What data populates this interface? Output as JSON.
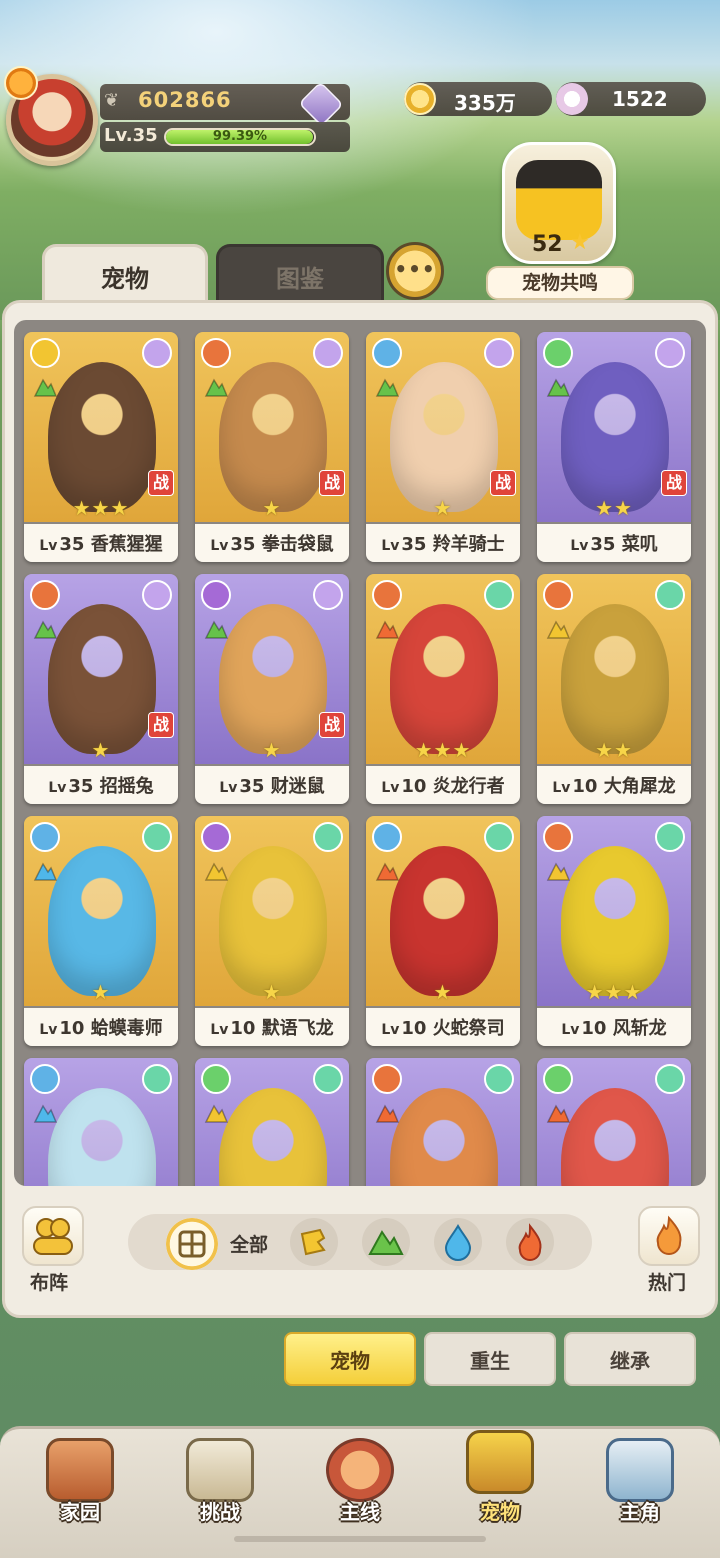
{
  "player": {
    "power": "602866",
    "level": "Lv.35",
    "exp_percent": "99.39%",
    "exp_fraction": 0.9939
  },
  "currency": {
    "gold": "335万",
    "shells": "1522"
  },
  "resonance": {
    "count": "52",
    "star": "★",
    "label": "宠物共鸣"
  },
  "chat": {
    "icon": "chat-bubble-icon",
    "glyph": "•••"
  },
  "tabs": [
    {
      "label": "宠物",
      "active": true
    },
    {
      "label": "图鉴",
      "active": false
    }
  ],
  "pets": [
    {
      "lv": "Lv",
      "level": "35",
      "name": "香蕉猩猩",
      "stars": "★★★",
      "battle": "战",
      "bg": "gold",
      "body": "#6b4a33",
      "tl": "#f2c531",
      "tr": "#c3a4ec",
      "el": "#66c24a"
    },
    {
      "lv": "Lv",
      "level": "35",
      "name": "拳击袋鼠",
      "stars": "★",
      "battle": "战",
      "bg": "gold",
      "body": "#c58a4d",
      "tl": "#e8743c",
      "tr": "#c3a4ec",
      "el": "#66c24a"
    },
    {
      "lv": "Lv",
      "level": "35",
      "name": "羚羊骑士",
      "stars": "★",
      "battle": "战",
      "bg": "gold",
      "body": "#f0cfae",
      "tl": "#5fb2e6",
      "tr": "#c3a4ec",
      "el": "#66c24a"
    },
    {
      "lv": "Lv",
      "level": "35",
      "name": "菜叽",
      "stars": "★★",
      "battle": "战",
      "bg": "purple",
      "body": "#6f5fc0",
      "tl": "#6bd06b",
      "tr": "#c3a4ec",
      "el": "#66c24a"
    },
    {
      "lv": "Lv",
      "level": "35",
      "name": "招摇兔",
      "stars": "★",
      "battle": "战",
      "bg": "purple",
      "body": "#7a5238",
      "tl": "#e8743c",
      "tr": "#c3a4ec",
      "el": "#66c24a"
    },
    {
      "lv": "Lv",
      "level": "35",
      "name": "财迷鼠",
      "stars": "★",
      "battle": "战",
      "bg": "purple",
      "body": "#e0a45a",
      "tl": "#a56ad6",
      "tr": "#c3a4ec",
      "el": "#66c24a"
    },
    {
      "lv": "Lv",
      "level": "10",
      "name": "炎龙行者",
      "stars": "★★★",
      "battle": "",
      "bg": "gold",
      "body": "#d6453a",
      "tl": "#e8743c",
      "tr": "#6ad6a8",
      "el": "#ef6a34"
    },
    {
      "lv": "Lv",
      "level": "10",
      "name": "大角犀龙",
      "stars": "★★",
      "battle": "",
      "bg": "gold",
      "body": "#c9a13c",
      "tl": "#e8743c",
      "tr": "#6ad6a8",
      "el": "#f2c531"
    },
    {
      "lv": "Lv",
      "level": "10",
      "name": "蛤蟆毒师",
      "stars": "★",
      "battle": "",
      "bg": "gold",
      "body": "#58b8e6",
      "tl": "#5fb2e6",
      "tr": "#6ad6a8",
      "el": "#4fb7ea"
    },
    {
      "lv": "Lv",
      "level": "10",
      "name": "默语飞龙",
      "stars": "★",
      "battle": "",
      "bg": "gold",
      "body": "#e8c23a",
      "tl": "#a56ad6",
      "tr": "#6ad6a8",
      "el": "#f2c531"
    },
    {
      "lv": "Lv",
      "level": "10",
      "name": "火蛇祭司",
      "stars": "★",
      "battle": "",
      "bg": "gold",
      "body": "#c8342f",
      "tl": "#5fb2e6",
      "tr": "#6ad6a8",
      "el": "#ef6a34"
    },
    {
      "lv": "Lv",
      "level": "10",
      "name": "风斩龙",
      "stars": "★★★",
      "battle": "",
      "bg": "purple",
      "body": "#e8c92e",
      "tl": "#e8743c",
      "tr": "#6ad6a8",
      "el": "#f2c531"
    },
    {
      "lv": "",
      "level": "",
      "name": "",
      "stars": "",
      "battle": "",
      "bg": "purple",
      "body": "#bfe2ee",
      "tl": "#5fb2e6",
      "tr": "#6ad6a8",
      "el": "#4fb7ea"
    },
    {
      "lv": "",
      "level": "",
      "name": "",
      "stars": "",
      "battle": "",
      "bg": "purple",
      "body": "#e8c23a",
      "tl": "#6bd06b",
      "tr": "#6ad6a8",
      "el": "#f2c531"
    },
    {
      "lv": "",
      "level": "",
      "name": "",
      "stars": "",
      "battle": "",
      "bg": "purple",
      "body": "#e08a4a",
      "tl": "#e8743c",
      "tr": "#6ad6a8",
      "el": "#ef6a34"
    },
    {
      "lv": "",
      "level": "",
      "name": "",
      "stars": "",
      "battle": "",
      "bg": "purple",
      "body": "#e0574a",
      "tl": "#6bd06b",
      "tr": "#6ad6a8",
      "el": "#ef6a34"
    }
  ],
  "filters": {
    "formation_label": "布阵",
    "all_label": "全部",
    "hot_label": "热门",
    "types": [
      "earth-type-icon",
      "grass-type-icon",
      "water-type-icon",
      "fire-type-icon"
    ]
  },
  "sub_buttons": [
    {
      "label": "宠物",
      "active": true
    },
    {
      "label": "重生",
      "active": false
    },
    {
      "label": "继承",
      "active": false
    }
  ],
  "nav": [
    {
      "label": "家园",
      "icon": "home-icon",
      "active": false
    },
    {
      "label": "挑战",
      "icon": "challenge-icon",
      "active": false
    },
    {
      "label": "主线",
      "icon": "mainline-icon",
      "active": false
    },
    {
      "label": "宠物",
      "icon": "pet-icon",
      "active": true
    },
    {
      "label": "主角",
      "icon": "hero-icon",
      "active": false
    }
  ],
  "colors": {
    "accent_gold": "#f4cf3a",
    "card_gold": "#e0a63a",
    "card_purple": "#8a73c8",
    "battle_red": "#e0443a"
  }
}
